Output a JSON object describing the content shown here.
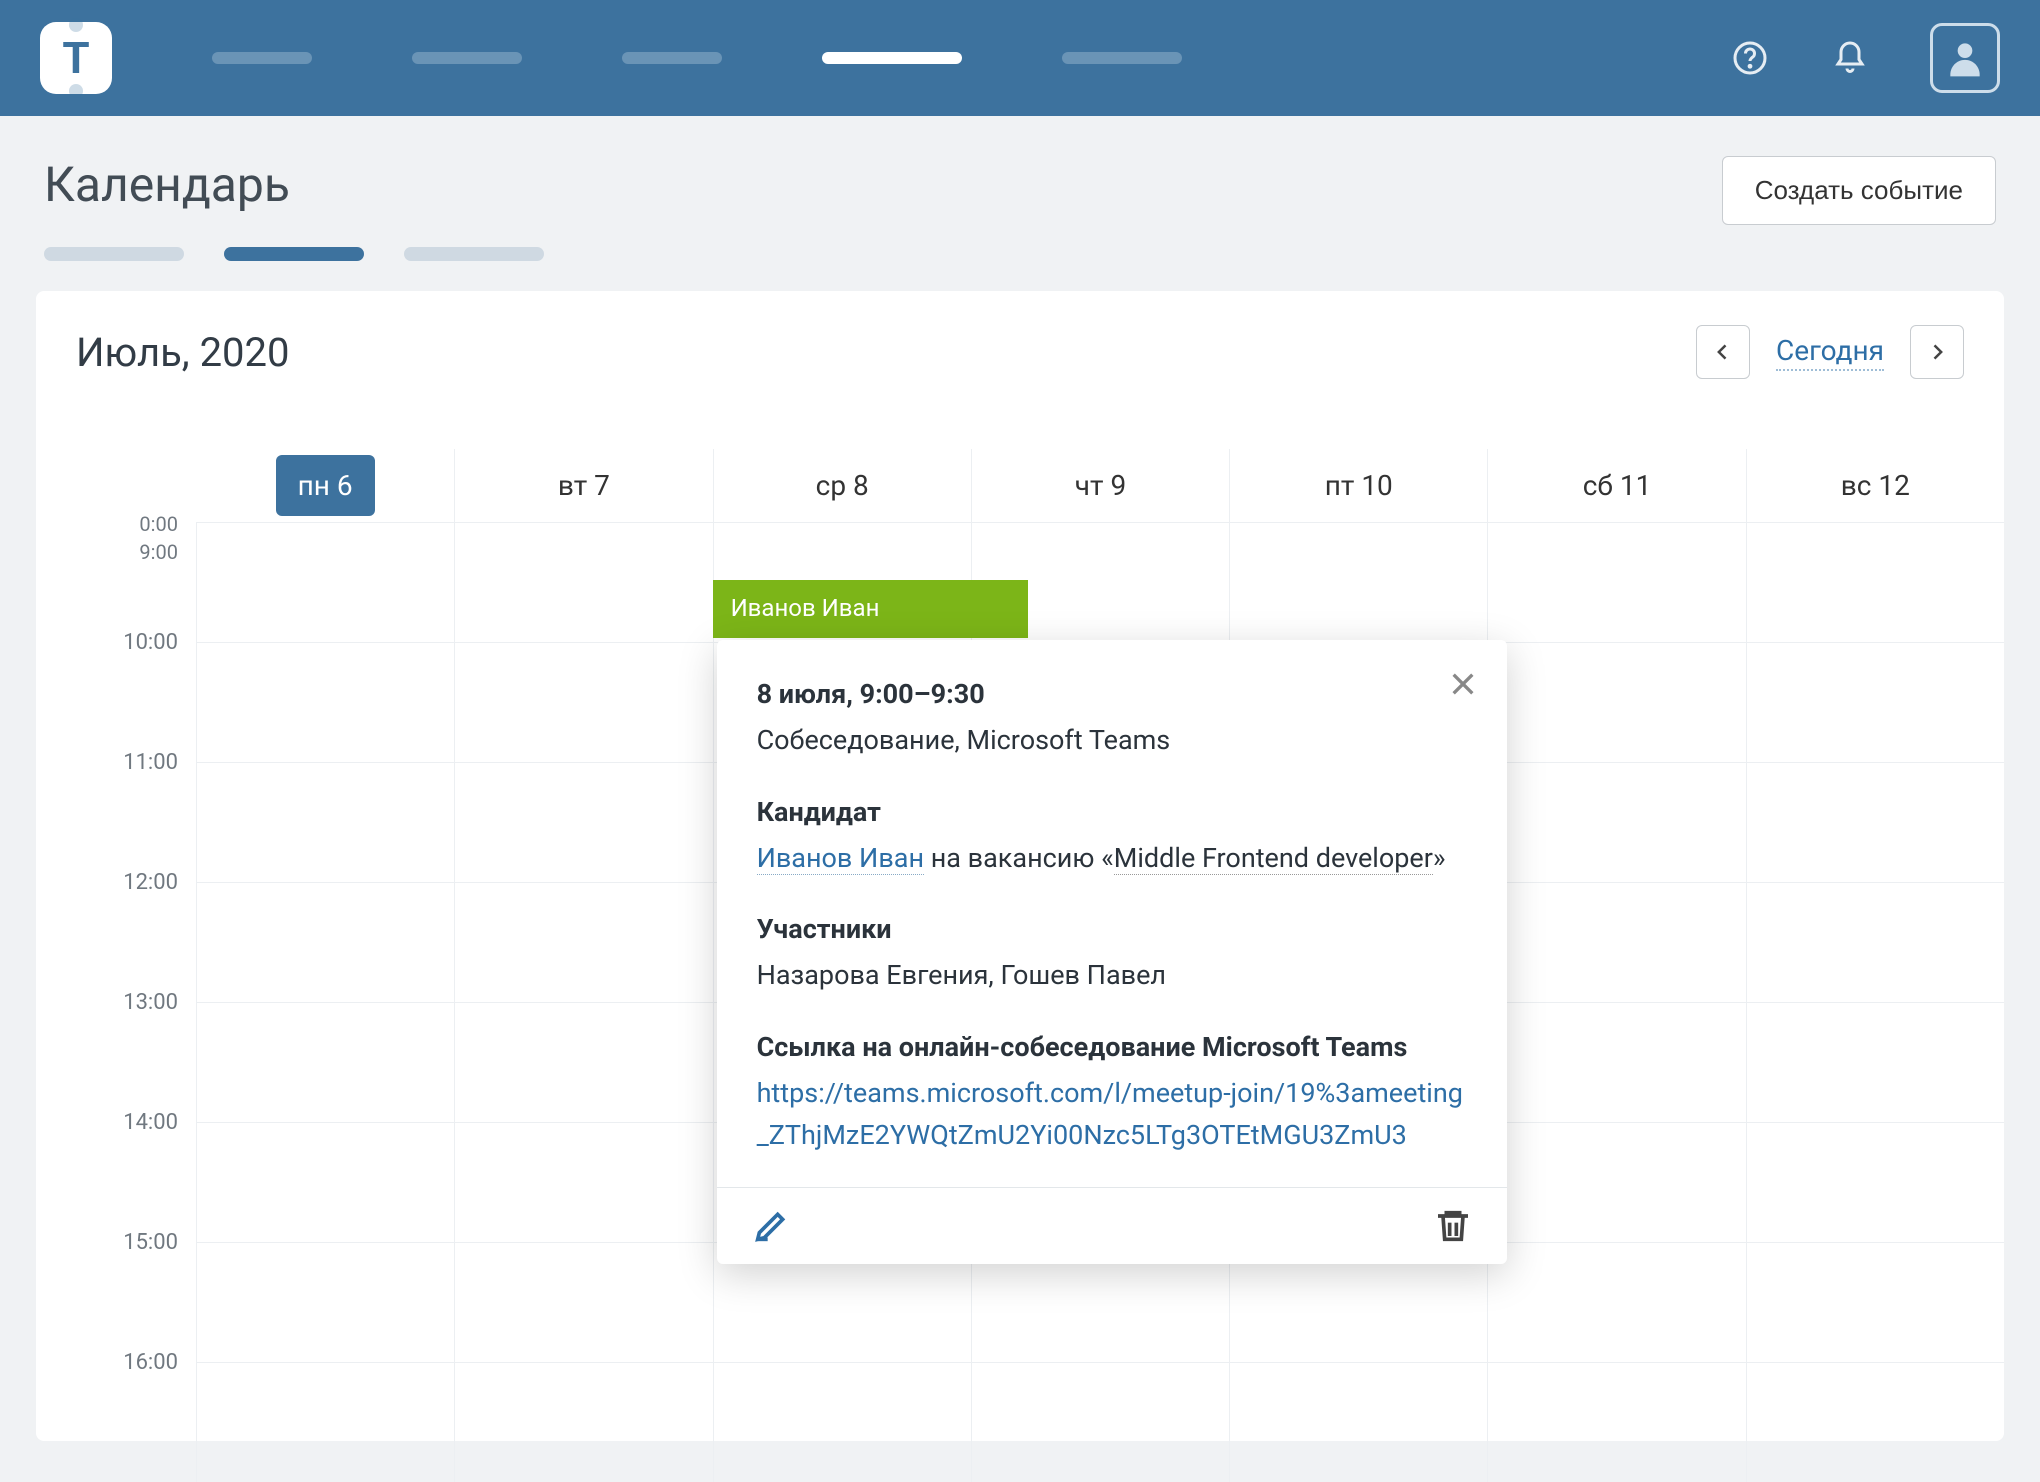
{
  "logo_letter": "T",
  "page_title": "Календарь",
  "create_button": "Создать событие",
  "month_label": "Июль, 2020",
  "today_link": "Сегодня",
  "days": [
    {
      "label": "пн 6",
      "today": true
    },
    {
      "label": "вт 7"
    },
    {
      "label": "ср 8"
    },
    {
      "label": "чт 9"
    },
    {
      "label": "пт 10"
    },
    {
      "label": "сб 11"
    },
    {
      "label": "вс 12"
    }
  ],
  "time_labels": {
    "t0": "0:00\n9:00",
    "t10": "10:00",
    "t11": "11:00",
    "t12": "12:00",
    "t13": "13:00",
    "t14": "14:00",
    "t15": "15:00",
    "t16": "16:00"
  },
  "event": {
    "title": "Иванов Иван"
  },
  "popover": {
    "datetime": "8 июля, 9:00–9:30",
    "subject": "Собеседование, Microsoft Teams",
    "candidate_heading": "Кандидат",
    "candidate_name": "Иванов Иван",
    "candidate_middle": " на вакансию «",
    "candidate_vacancy": "Middle Frontend developer",
    "candidate_after": "»",
    "participants_heading": "Участники",
    "participants": "Назарова Евгения, Гошев Павел",
    "link_heading": "Ссылка на онлайн-собеседование Microsoft Teams",
    "link_url": "https://teams.microsoft.com/l/meetup-join/19%3ameeting_ZThjMzE2YWQtZmU2Yi00Nzc5LTg3OTEtMGU3ZmU3"
  }
}
